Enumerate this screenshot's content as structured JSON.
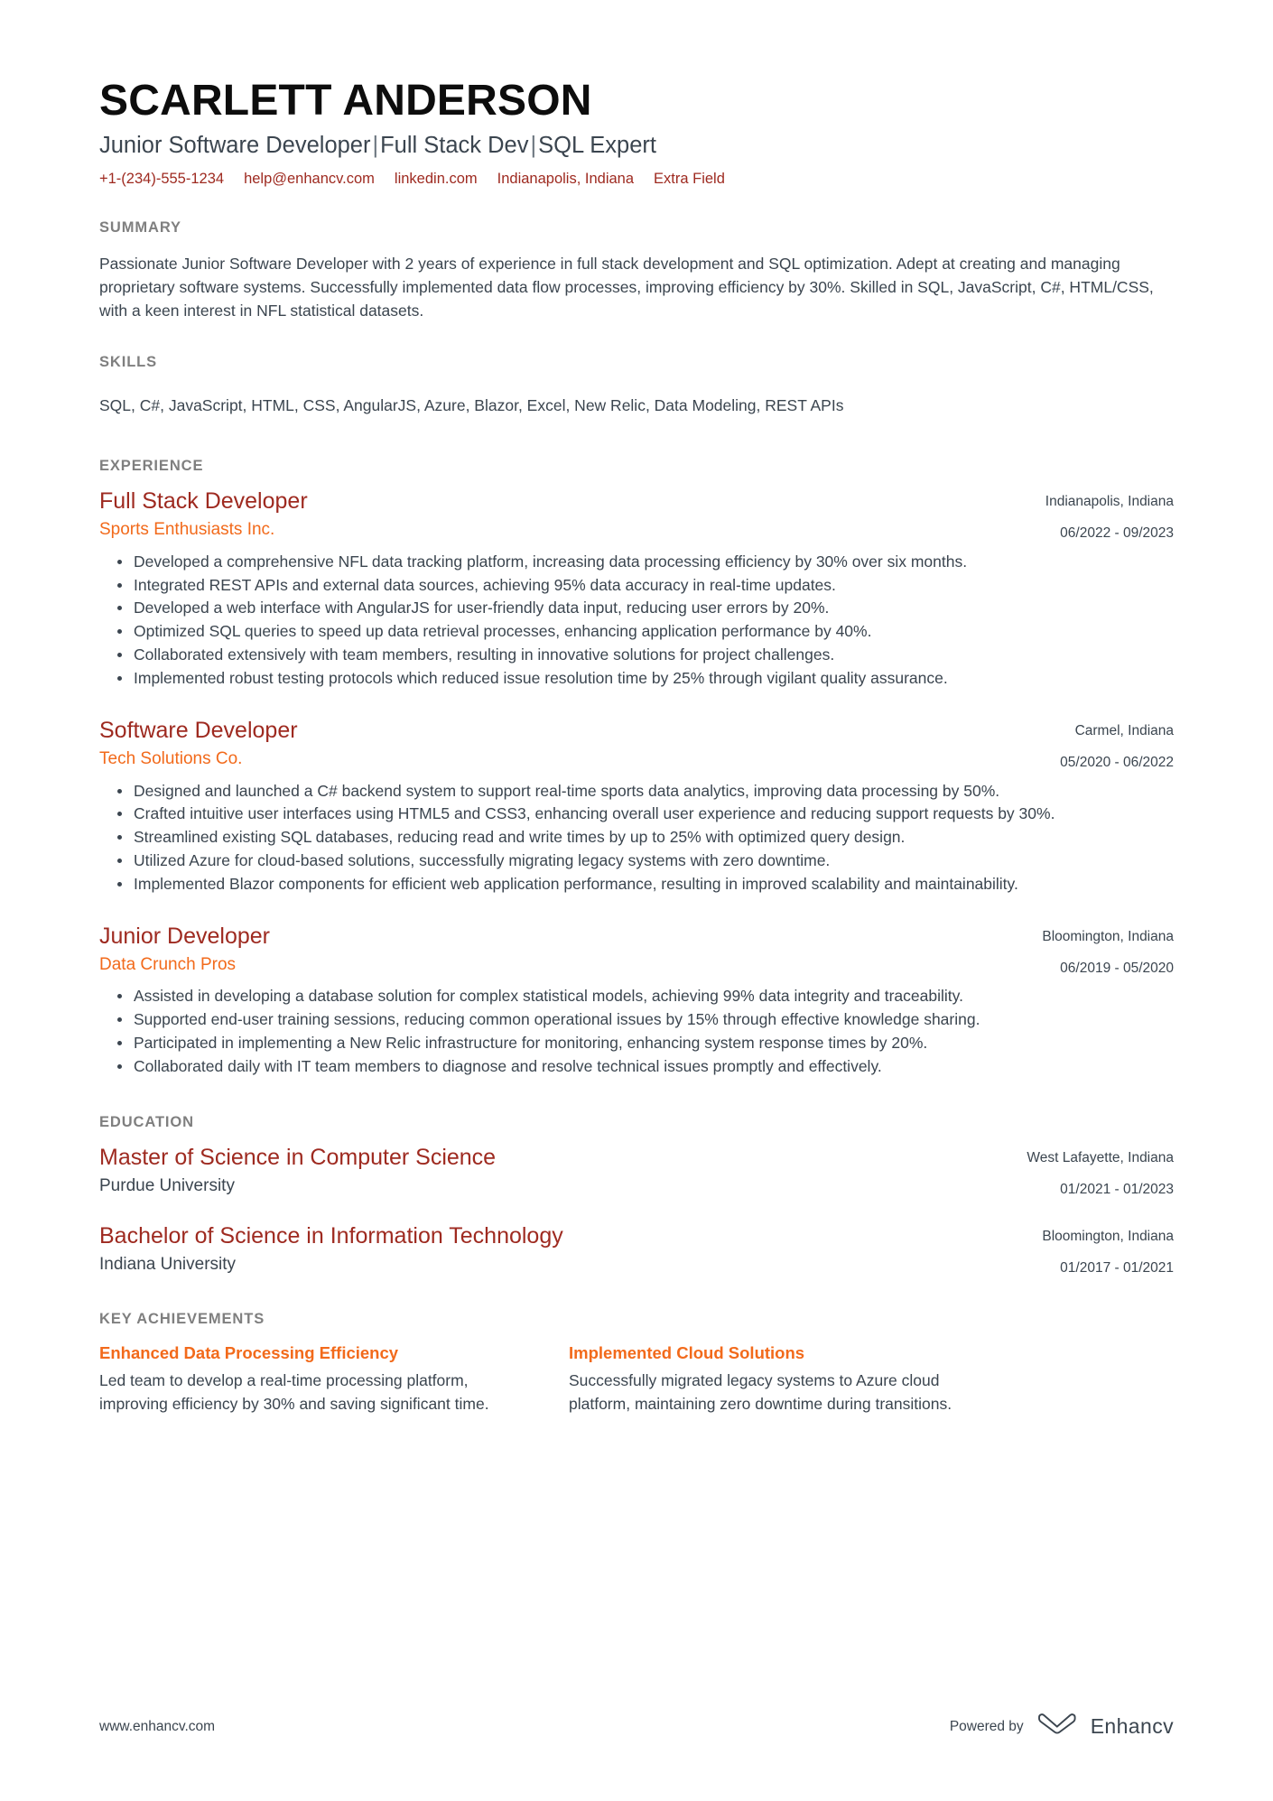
{
  "colors": {
    "accent_dark_red": "#9e2a20",
    "accent_orange": "#f26a1b",
    "heading_gray": "#7f7f7f",
    "body_slate": "#3b454f",
    "name_black": "#0d0d0d",
    "background": "#ffffff"
  },
  "header": {
    "name": "SCARLETT ANDERSON",
    "headline_parts": [
      "Junior Software Developer",
      "Full Stack Dev",
      "SQL Expert"
    ],
    "headline_separator": "|",
    "contacts": [
      "+1-(234)-555-1234",
      "help@enhancv.com",
      "linkedin.com",
      "Indianapolis, Indiana",
      "Extra Field"
    ]
  },
  "sections": {
    "summary": {
      "title": "SUMMARY",
      "text": "Passionate Junior Software Developer with 2 years of experience in full stack development and SQL optimization. Adept at creating and managing proprietary software systems. Successfully implemented data flow processes, improving efficiency by 30%. Skilled in SQL, JavaScript, C#, HTML/CSS, with a keen interest in NFL statistical datasets."
    },
    "skills": {
      "title": "SKILLS",
      "text": "SQL, C#, JavaScript, HTML, CSS, AngularJS, Azure, Blazor, Excel, New Relic, Data Modeling, REST APIs"
    },
    "experience": {
      "title": "EXPERIENCE",
      "entries": [
        {
          "title": "Full Stack Developer",
          "org": "Sports Enthusiasts Inc.",
          "location": "Indianapolis, Indiana",
          "dates": "06/2022 - 09/2023",
          "bullets": [
            "Developed a comprehensive NFL data tracking platform, increasing data processing efficiency by 30% over six months.",
            "Integrated REST APIs and external data sources, achieving 95% data accuracy in real-time updates.",
            "Developed a web interface with AngularJS for user-friendly data input, reducing user errors by 20%.",
            "Optimized SQL queries to speed up data retrieval processes, enhancing application performance by 40%.",
            "Collaborated extensively with team members, resulting in innovative solutions for project challenges.",
            "Implemented robust testing protocols which reduced issue resolution time by 25% through vigilant quality assurance."
          ]
        },
        {
          "title": "Software Developer",
          "org": "Tech Solutions Co.",
          "location": "Carmel, Indiana",
          "dates": "05/2020 - 06/2022",
          "bullets": [
            "Designed and launched a C# backend system to support real-time sports data analytics, improving data processing by 50%.",
            "Crafted intuitive user interfaces using HTML5 and CSS3, enhancing overall user experience and reducing support requests by 30%.",
            "Streamlined existing SQL databases, reducing read and write times by up to 25% with optimized query design.",
            "Utilized Azure for cloud-based solutions, successfully migrating legacy systems with zero downtime.",
            "Implemented Blazor components for efficient web application performance, resulting in improved scalability and maintainability."
          ]
        },
        {
          "title": "Junior Developer",
          "org": "Data Crunch Pros",
          "location": "Bloomington, Indiana",
          "dates": "06/2019 - 05/2020",
          "bullets": [
            "Assisted in developing a database solution for complex statistical models, achieving 99% data integrity and traceability.",
            "Supported end-user training sessions, reducing common operational issues by 15% through effective knowledge sharing.",
            "Participated in implementing a New Relic infrastructure for monitoring, enhancing system response times by 20%.",
            "Collaborated daily with IT team members to diagnose and resolve technical issues promptly and effectively."
          ]
        }
      ]
    },
    "education": {
      "title": "EDUCATION",
      "entries": [
        {
          "title": "Master of Science in Computer Science",
          "org": "Purdue University",
          "location": "West Lafayette, Indiana",
          "dates": "01/2021 - 01/2023"
        },
        {
          "title": "Bachelor of Science in Information Technology",
          "org": "Indiana University",
          "location": "Bloomington, Indiana",
          "dates": "01/2017 - 01/2021"
        }
      ]
    },
    "key_achievements": {
      "title": "KEY ACHIEVEMENTS",
      "items": [
        {
          "title": "Enhanced Data Processing Efficiency",
          "text": "Led team to develop a real-time processing platform, improving efficiency by 30% and saving significant time."
        },
        {
          "title": "Implemented Cloud Solutions",
          "text": "Successfully migrated legacy systems to Azure cloud platform, maintaining zero downtime during transitions."
        }
      ]
    }
  },
  "footer": {
    "url": "www.enhancv.com",
    "powered_by": "Powered by",
    "brand": "Enhancv",
    "logo_icon": "enhancv-infinity-icon"
  }
}
